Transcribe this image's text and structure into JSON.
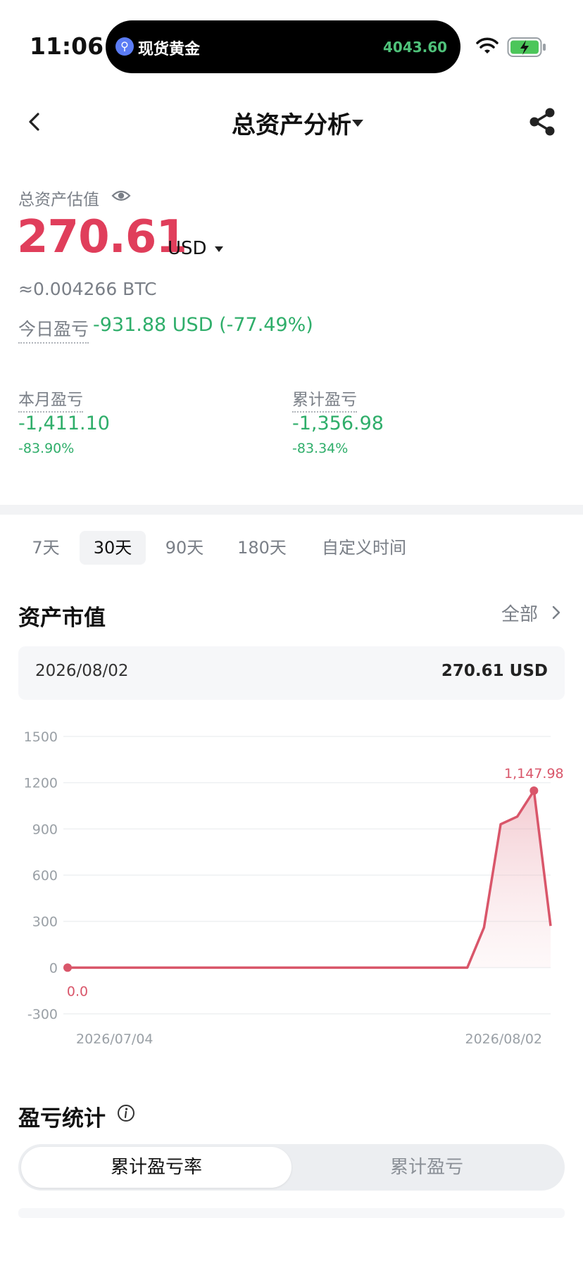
{
  "status_bar": {
    "time": "11:06",
    "island_app": "现货黄金",
    "island_price": "4043.60",
    "island_icon": "gold-app-icon",
    "wifi_icon": "wifi-icon",
    "battery_icon": "battery-charging-icon"
  },
  "nav": {
    "title": "总资产分析",
    "back_icon": "chevron-left-icon",
    "share_icon": "share-icon",
    "dropdown_icon": "caret-down-icon"
  },
  "summary": {
    "estimate_label": "总资产估值",
    "eye_icon": "eye-icon",
    "value": "270.61",
    "currency": "USD",
    "btc": "≈0.004266 BTC",
    "today_label": "今日盈亏",
    "today_value": "-931.88 USD (-77.49%)",
    "month_label": "本月盈亏",
    "month_value": "-1,411.10",
    "month_pct": "-83.90%",
    "total_label": "累计盈亏",
    "total_value": "-1,356.98",
    "total_pct": "-83.34%"
  },
  "tabs": [
    {
      "label": "7天"
    },
    {
      "label": "30天",
      "active": true
    },
    {
      "label": "90天"
    },
    {
      "label": "180天"
    },
    {
      "label": "自定义时间"
    }
  ],
  "asset_section": {
    "title": "资产市值",
    "all_label": "全部",
    "date": "2026/08/02",
    "date_value": "270.61 USD"
  },
  "colors": {
    "accent_red": "#e03e5b",
    "gain_green": "#2fae6a",
    "line_red": "#d9566a"
  },
  "chart_data": {
    "type": "area",
    "y_ticks": [
      "1500",
      "1200",
      "900",
      "600",
      "300",
      "0",
      "-300"
    ],
    "ylim": [
      -300,
      1500
    ],
    "x_labels": [
      "2026/07/04",
      "2026/08/02"
    ],
    "x": [
      "07/04",
      "07/05",
      "07/06",
      "07/07",
      "07/08",
      "07/09",
      "07/10",
      "07/11",
      "07/12",
      "07/13",
      "07/14",
      "07/15",
      "07/16",
      "07/17",
      "07/18",
      "07/19",
      "07/20",
      "07/21",
      "07/22",
      "07/23",
      "07/24",
      "07/25",
      "07/26",
      "07/27",
      "07/28",
      "07/29",
      "07/30",
      "07/31",
      "08/01",
      "08/02"
    ],
    "values": [
      0,
      0,
      0,
      0,
      0,
      0,
      0,
      0,
      0,
      0,
      0,
      0,
      0,
      0,
      0,
      0,
      0,
      0,
      0,
      0,
      0,
      0,
      0,
      0,
      0,
      260,
      930,
      980,
      1147.98,
      270.61
    ],
    "min_label": "0.0",
    "max_label": "1,147.98",
    "grid": true
  },
  "pnl_section": {
    "title": "盈亏统计",
    "info_icon": "info-icon",
    "seg_active": "累计盈亏率",
    "seg_inactive": "累计盈亏"
  }
}
